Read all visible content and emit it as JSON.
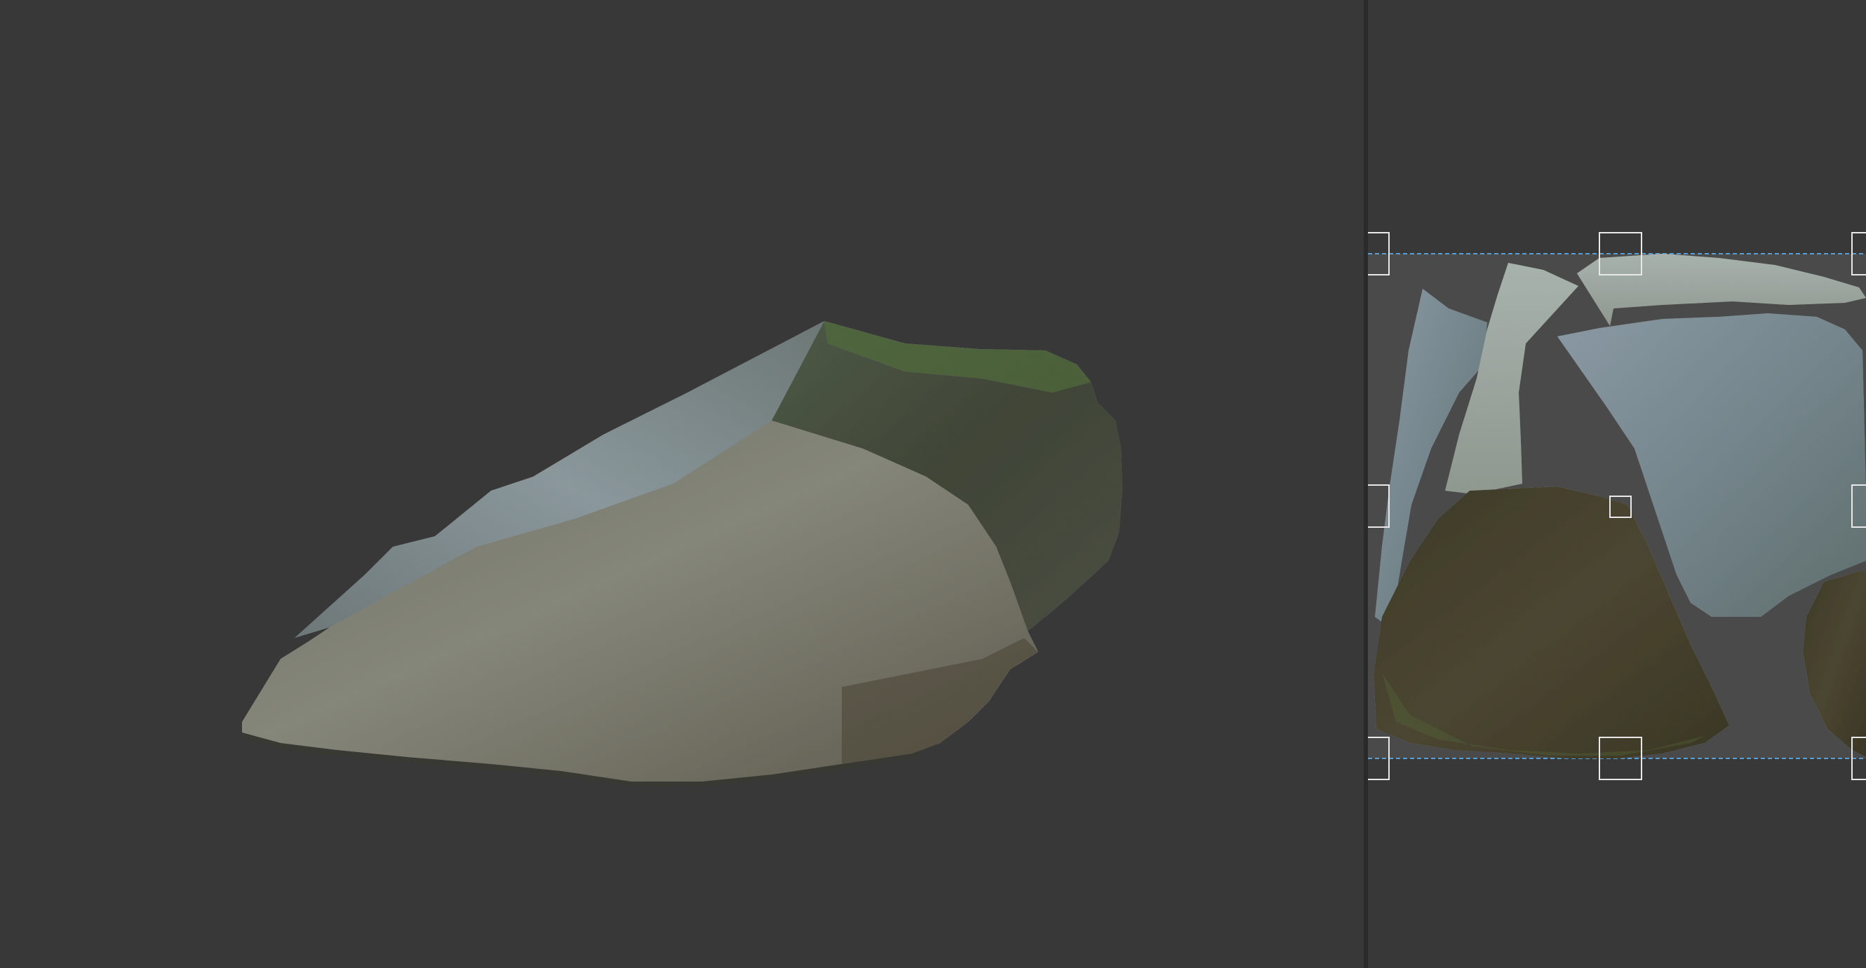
{
  "viewport": {
    "background_color": "#383838",
    "model": "rock-mesh"
  },
  "uv_editor": {
    "background_color": "#383838",
    "uv_area_color": "#4a4a4a",
    "bounds_line_color": "#5a9fd4",
    "handle_color": "#e8e8e8",
    "islands": [
      "uv-island-left-strip",
      "uv-island-light-strip",
      "uv-island-top-sliver",
      "uv-island-large-blue",
      "uv-island-dark-bottom",
      "uv-island-right-edge"
    ]
  },
  "splitter": {
    "color": "#2a2a2a"
  }
}
